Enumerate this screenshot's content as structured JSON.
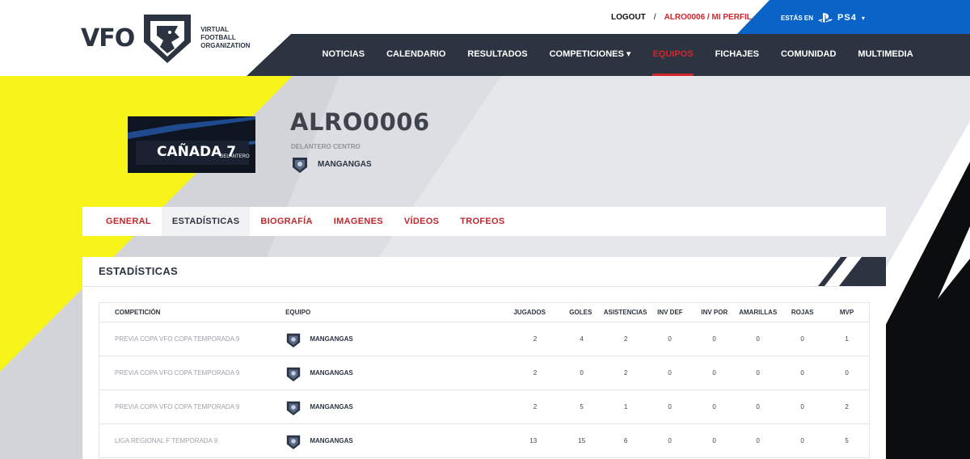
{
  "brand": {
    "short": "VFO",
    "tagline": [
      "Virtual",
      "Football",
      "Organization"
    ]
  },
  "top_links": {
    "logout": "LOGOUT",
    "separator": "/",
    "profile": "ALRO0006 / MI PERFIL"
  },
  "platform": {
    "label": "ESTÁS EN",
    "name": "PS4",
    "caret": "▾"
  },
  "nav": [
    {
      "label": "NOTICIAS",
      "active": false
    },
    {
      "label": "CALENDARIO",
      "active": false
    },
    {
      "label": "RESULTADOS",
      "active": false
    },
    {
      "label": "COMPETICIONES ▾",
      "active": false
    },
    {
      "label": "EQUIPOS",
      "active": true
    },
    {
      "label": "FICHAJES",
      "active": false
    },
    {
      "label": "COMUNIDAD",
      "active": false
    },
    {
      "label": "MULTIMEDIA",
      "active": false
    }
  ],
  "player": {
    "banner_name": "CAÑADA 7",
    "banner_position": "DELANTERO",
    "username": "ALRO0006",
    "position": "DELANTERO CENTRO",
    "team": "MANGANGAS"
  },
  "tabs": [
    {
      "label": "GENERAL",
      "active": false
    },
    {
      "label": "ESTADÍSTICAS",
      "active": true
    },
    {
      "label": "BIOGRAFÍA",
      "active": false
    },
    {
      "label": "IMAGENES",
      "active": false
    },
    {
      "label": "VÍDEOS",
      "active": false
    },
    {
      "label": "TROFEOS",
      "active": false
    }
  ],
  "stats": {
    "title": "ESTADÍSTICAS",
    "columns": [
      "COMPETICIÓN",
      "EQUIPO",
      "JUGADOS",
      "GOLES",
      "ASISTENCIAS",
      "INV DEF",
      "INV POR",
      "AMARILLAS",
      "ROJAS",
      "MVP"
    ],
    "rows": [
      {
        "competicion": "PREVIA COPA VFO COPA TEMPORADA 9",
        "equipo": "MANGANGAS",
        "jugados": "2",
        "goles": "4",
        "asistencias": "2",
        "inv_def": "0",
        "inv_por": "0",
        "amarillas": "0",
        "rojas": "0",
        "mvp": "1"
      },
      {
        "competicion": "PREVIA COPA VFO COPA TEMPORADA 9",
        "equipo": "MANGANGAS",
        "jugados": "2",
        "goles": "0",
        "asistencias": "2",
        "inv_def": "0",
        "inv_por": "0",
        "amarillas": "0",
        "rojas": "0",
        "mvp": "0"
      },
      {
        "competicion": "PREVIA COPA VFO COPA TEMPORADA 9",
        "equipo": "MANGANGAS",
        "jugados": "2",
        "goles": "5",
        "asistencias": "1",
        "inv_def": "0",
        "inv_por": "0",
        "amarillas": "0",
        "rojas": "0",
        "mvp": "2"
      },
      {
        "competicion": "LIGA REGIONAL F TEMPORADA 9",
        "equipo": "MANGANGAS",
        "jugados": "13",
        "goles": "15",
        "asistencias": "6",
        "inv_def": "0",
        "inv_por": "0",
        "amarillas": "0",
        "rojas": "0",
        "mvp": "5"
      }
    ]
  },
  "colors": {
    "dark_navy": "#2b3440",
    "accent_red": "#d1262e",
    "ps_blue": "#0a64c8",
    "yellow": "#f7f41a"
  }
}
